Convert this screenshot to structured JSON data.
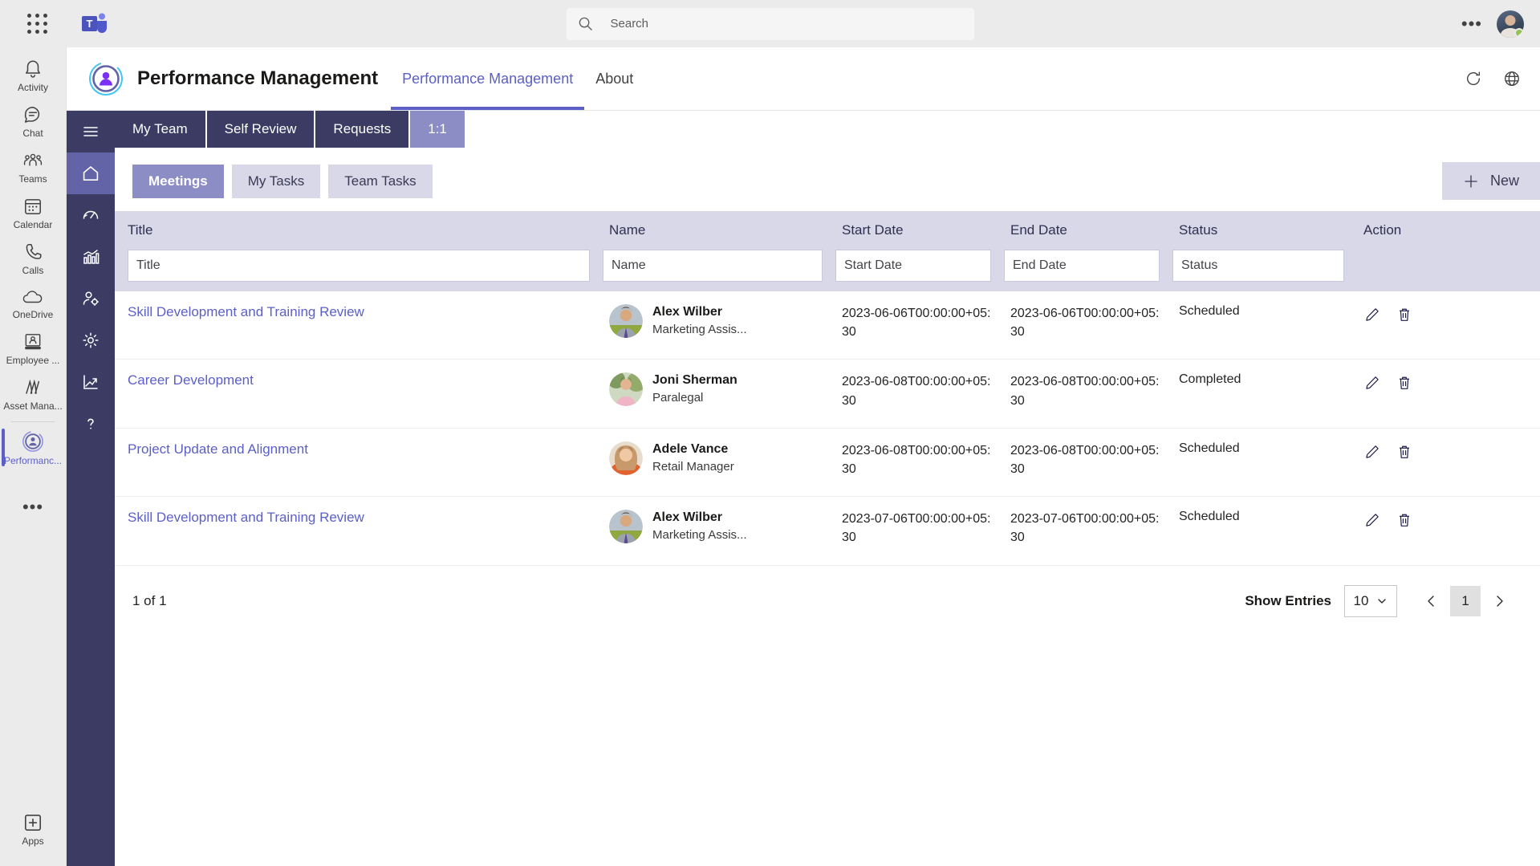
{
  "topbar": {
    "waffle_label": "app-launcher",
    "search_placeholder": "Search",
    "search_value": "",
    "more_label": "•••"
  },
  "rail": {
    "items": [
      {
        "label": "Activity",
        "icon": "bell-icon",
        "active": false
      },
      {
        "label": "Chat",
        "icon": "chat-icon",
        "active": false
      },
      {
        "label": "Teams",
        "icon": "teams-icon",
        "active": false
      },
      {
        "label": "Calendar",
        "icon": "calendar-icon",
        "active": false
      },
      {
        "label": "Calls",
        "icon": "calls-icon",
        "active": false
      },
      {
        "label": "OneDrive",
        "icon": "cloud-icon",
        "active": false
      },
      {
        "label": "Employee ...",
        "icon": "employee-icon",
        "active": false
      },
      {
        "label": "Asset Mana...",
        "icon": "asset-icon",
        "active": false
      },
      {
        "label": "Performanc...",
        "icon": "performance-icon",
        "active": true
      }
    ],
    "more_label": "•••",
    "apps_label": "Apps"
  },
  "app_header": {
    "title": "Performance Management",
    "tabs": [
      {
        "label": "Performance Management",
        "active": true
      },
      {
        "label": "About",
        "active": false
      }
    ],
    "refresh_icon": "refresh-icon",
    "globe_icon": "globe-icon"
  },
  "darknav": {
    "items": [
      {
        "icon": "hamburger-icon",
        "active": false
      },
      {
        "icon": "home-icon",
        "active": true
      },
      {
        "icon": "gauge-icon",
        "active": false
      },
      {
        "icon": "bar-chart-icon",
        "active": false
      },
      {
        "icon": "user-settings-icon",
        "active": false
      },
      {
        "icon": "gear-icon",
        "active": false
      },
      {
        "icon": "trend-up-icon",
        "active": false
      },
      {
        "icon": "help-icon",
        "active": false
      }
    ]
  },
  "section_tabs": [
    {
      "label": "My Team",
      "active": false
    },
    {
      "label": "Self Review",
      "active": false
    },
    {
      "label": "Requests",
      "active": false
    },
    {
      "label": "1:1",
      "active": true
    }
  ],
  "sub_tabs": [
    {
      "label": "Meetings",
      "active": true
    },
    {
      "label": "My Tasks",
      "active": false
    },
    {
      "label": "Team Tasks",
      "active": false
    }
  ],
  "new_button": {
    "label": "New",
    "icon": "plus-icon"
  },
  "table": {
    "columns": [
      "Title",
      "Name",
      "Start Date",
      "End Date",
      "Status",
      "Action"
    ],
    "filters": [
      {
        "placeholder": "Title",
        "value": ""
      },
      {
        "placeholder": "Name",
        "value": ""
      },
      {
        "placeholder": "Start Date",
        "value": ""
      },
      {
        "placeholder": "End Date",
        "value": ""
      },
      {
        "placeholder": "Status",
        "value": ""
      }
    ],
    "rows": [
      {
        "title": "Skill Development and Training Review",
        "name": "Alex Wilber",
        "role": "Marketing Assis...",
        "avatar": "alex-wilber-avatar",
        "start_date": "2023-06-06T00:00:00+05:30",
        "end_date": "2023-06-06T00:00:00+05:30",
        "status": "Scheduled"
      },
      {
        "title": "Career Development",
        "name": "Joni Sherman",
        "role": "Paralegal",
        "avatar": "joni-sherman-avatar",
        "start_date": "2023-06-08T00:00:00+05:30",
        "end_date": "2023-06-08T00:00:00+05:30",
        "status": "Completed"
      },
      {
        "title": "Project Update and Alignment",
        "name": "Adele Vance",
        "role": "Retail Manager",
        "avatar": "adele-vance-avatar",
        "start_date": "2023-06-08T00:00:00+05:30",
        "end_date": "2023-06-08T00:00:00+05:30",
        "status": "Scheduled"
      },
      {
        "title": "Skill Development and Training Review",
        "name": "Alex Wilber",
        "role": "Marketing Assis...",
        "avatar": "alex-wilber-avatar",
        "start_date": "2023-07-06T00:00:00+05:30",
        "end_date": "2023-07-06T00:00:00+05:30",
        "status": "Scheduled"
      }
    ],
    "row_actions": {
      "edit_icon": "pencil-icon",
      "delete_icon": "trash-icon"
    }
  },
  "pagination": {
    "range_text": "1 of 1",
    "show_entries_label": "Show Entries",
    "page_size": "10",
    "current_page": "1",
    "prev_icon": "chevron-left-icon",
    "next_icon": "chevron-right-icon"
  },
  "colors": {
    "accent": "#5b5fc7",
    "dark_nav": "#3b3b63",
    "active_tab": "#8b8dc4",
    "header_bg": "#d8d8e8",
    "link": "#5b5fc7"
  }
}
